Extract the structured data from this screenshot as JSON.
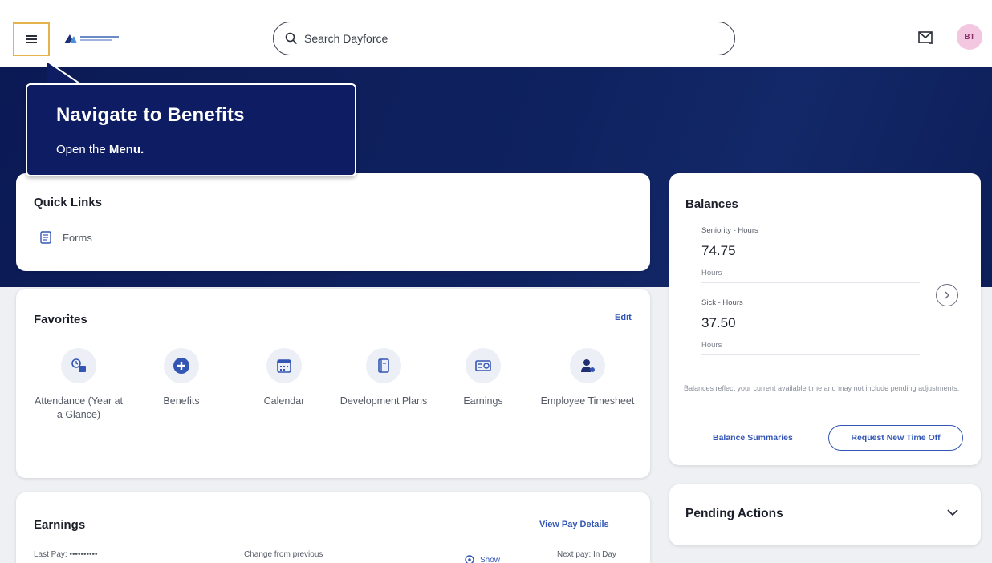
{
  "header": {
    "search_placeholder": "Search Dayforce",
    "avatar_initials": "BT"
  },
  "tooltip": {
    "title": "Navigate to Benefits",
    "body_prefix": "Open the ",
    "body_bold": "Menu."
  },
  "quick_links": {
    "title": "Quick Links",
    "items": [
      {
        "label": "Forms",
        "icon": "form-icon"
      }
    ]
  },
  "favorites": {
    "title": "Favorites",
    "edit_label": "Edit",
    "items": [
      {
        "label": "Attendance (Year at a Glance)",
        "icon": "attendance-icon"
      },
      {
        "label": "Benefits",
        "icon": "benefits-plus-icon"
      },
      {
        "label": "Calendar",
        "icon": "calendar-icon"
      },
      {
        "label": "Development Plans",
        "icon": "development-plans-icon"
      },
      {
        "label": "Earnings",
        "icon": "earnings-icon"
      },
      {
        "label": "Employee Timesheet",
        "icon": "employee-timesheet-icon"
      }
    ]
  },
  "earnings": {
    "title": "Earnings",
    "view_label": "View Pay Details",
    "last_pay": "Last Pay: ••••••••••",
    "change_label": "Change from previous",
    "show_label": "Show",
    "next_pay": "Next pay: In Day"
  },
  "balances": {
    "title": "Balances",
    "rows": [
      {
        "name": "Seniority - Hours",
        "value": "74.75",
        "unit": "Hours"
      },
      {
        "name": "Sick - Hours",
        "value": "37.50",
        "unit": "Hours"
      }
    ],
    "note": "Balances reflect your current available time and may not include pending adjustments.",
    "summaries_label": "Balance Summaries",
    "request_label": "Request New Time Off"
  },
  "pending": {
    "title": "Pending Actions"
  },
  "colors": {
    "banner": "#0f2260",
    "accent": "#3356b5",
    "highlight": "#e4b44a"
  }
}
